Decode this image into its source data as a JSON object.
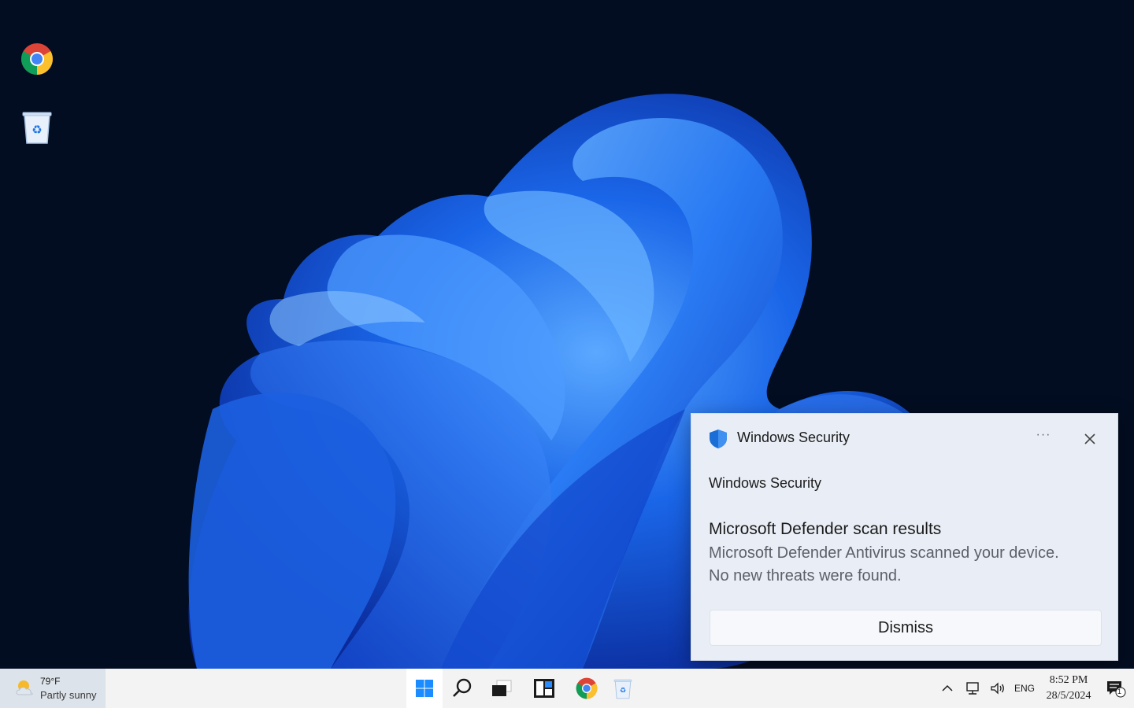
{
  "desktop": {
    "icons": [
      {
        "name": "Google Chrome",
        "icon": "chrome-icon"
      },
      {
        "name": "Recycle Bin",
        "icon": "recycle-bin-icon"
      }
    ]
  },
  "toast": {
    "header_title": "Windows Security",
    "more_label": "···",
    "app_name": "Windows Security",
    "title": "Microsoft Defender scan results",
    "body_line1": "Microsoft Defender Antivirus scanned your device.",
    "body_line2": "No new threats were found.",
    "dismiss_label": "Dismiss",
    "colors": {
      "shield": "#1b6ed6",
      "background": "#e9eef6"
    }
  },
  "taskbar": {
    "weather": {
      "temp": "79°F",
      "desc": "Partly sunny"
    },
    "apps": [
      "start-icon",
      "search-icon",
      "task-view-icon",
      "widgets-icon",
      "chrome-icon",
      "recycle-bin-icon"
    ],
    "tray": {
      "language": "ENG",
      "time": "8:52 PM",
      "date": "28/5/2024",
      "notification_count": "1"
    }
  },
  "colors": {
    "accent": "#1a66e8",
    "desktop_bg": "#030d21",
    "taskbar_bg": "#f3f3f3"
  }
}
